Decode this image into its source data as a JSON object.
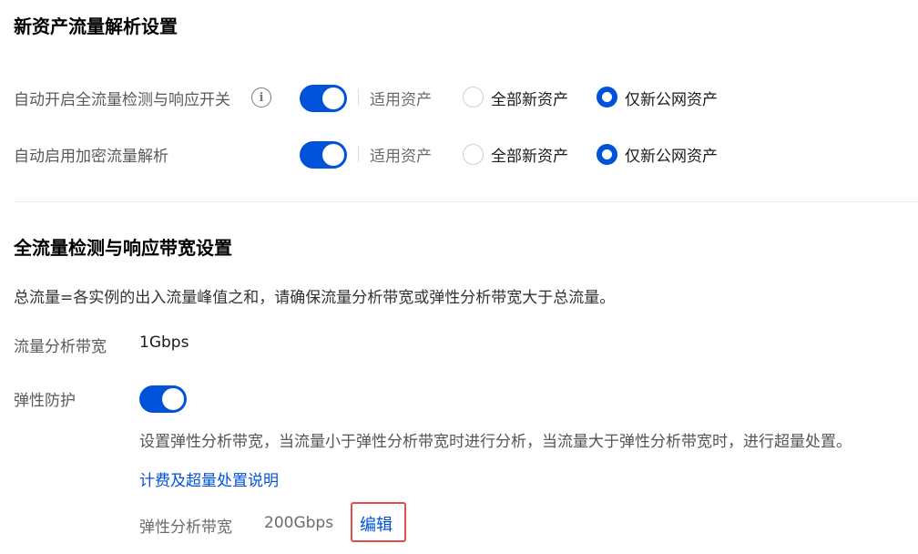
{
  "section1": {
    "title": "新资产流量解析设置",
    "rows": [
      {
        "label": "自动开启全流量检测与响应开关",
        "has_info_icon": true,
        "toggle_on": true,
        "scope_label": "适用资产",
        "options": [
          "全部新资产",
          "仅新公网资产"
        ],
        "selected": "仅新公网资产"
      },
      {
        "label": "自动启用加密流量解析",
        "has_info_icon": false,
        "toggle_on": true,
        "scope_label": "适用资产",
        "options": [
          "全部新资产",
          "仅新公网资产"
        ],
        "selected": "仅新公网资产"
      }
    ]
  },
  "section2": {
    "title": "全流量检测与响应带宽设置",
    "description": "总流量=各实例的出入流量峰值之和，请确保流量分析带宽或弹性分析带宽大于总流量。",
    "bandwidth_label": "流量分析带宽",
    "bandwidth_value": "1Gbps",
    "elastic": {
      "label": "弹性防护",
      "toggle_on": true,
      "description": "设置弹性分析带宽，当流量小于弹性分析带宽时进行分析，当流量大于弹性分析带宽时，进行超量处置。",
      "billing_link": "计费及超量处置说明",
      "elastic_bw_label": "弹性分析带宽",
      "elastic_bw_value": "200Gbps",
      "edit_label": "编辑"
    }
  },
  "colors": {
    "accent": "#0052d9",
    "highlight_border": "#e34d4d",
    "label_gray": "#5a5a5a"
  },
  "icons": {
    "info": "info-circle-icon"
  }
}
